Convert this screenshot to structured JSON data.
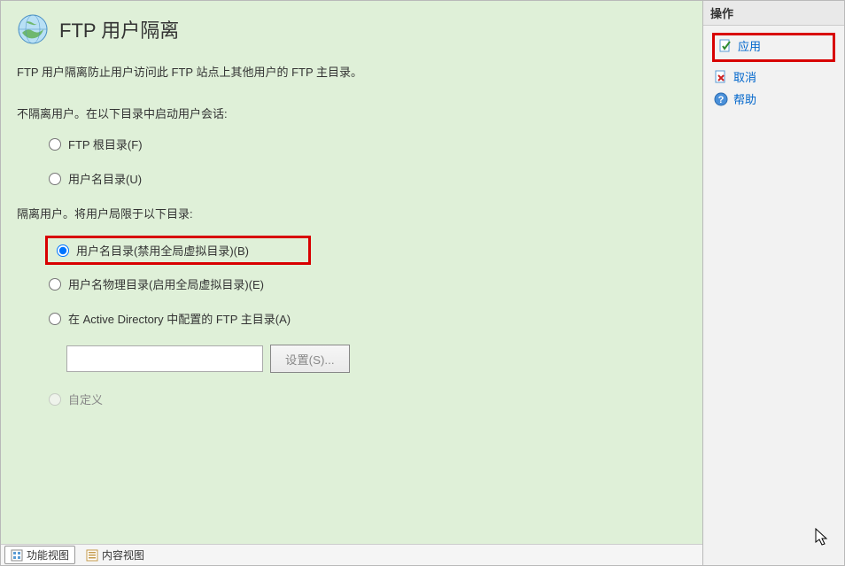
{
  "header": {
    "title": "FTP 用户隔离",
    "description": "FTP 用户隔离防止用户访问此 FTP 站点上其他用户的 FTP 主目录。"
  },
  "section1": {
    "label": "不隔离用户。在以下目录中启动用户会话:",
    "options": [
      {
        "label": "FTP 根目录(F)",
        "value": "ftp_root"
      },
      {
        "label": "用户名目录(U)",
        "value": "username_dir"
      }
    ]
  },
  "section2": {
    "label": "隔离用户。将用户局限于以下目录:",
    "options": [
      {
        "label": "用户名目录(禁用全局虚拟目录)(B)",
        "value": "username_disable_global"
      },
      {
        "label": "用户名物理目录(启用全局虚拟目录)(E)",
        "value": "username_physical"
      },
      {
        "label": "在 Active Directory 中配置的 FTP 主目录(A)",
        "value": "ad_home"
      }
    ],
    "settings_button": "设置(S)...",
    "custom_option": {
      "label": "自定义",
      "value": "custom"
    }
  },
  "tabs": {
    "features_view": "功能视图",
    "content_view": "内容视图"
  },
  "actions": {
    "header": "操作",
    "apply": "应用",
    "cancel": "取消",
    "help": "帮助"
  }
}
